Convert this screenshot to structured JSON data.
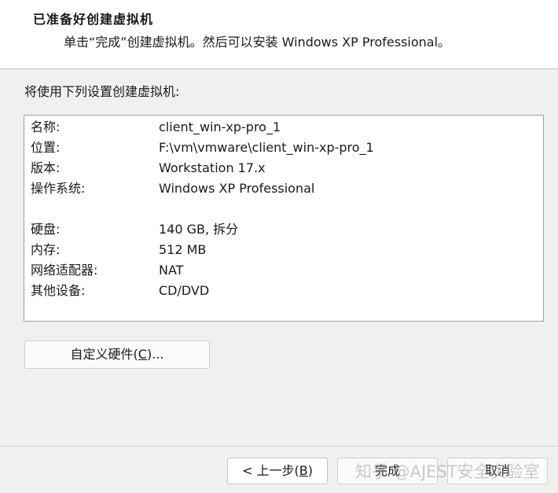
{
  "header": {
    "title": "已准备好创建虚拟机",
    "subtitle": "单击“完成”创建虚拟机。然后可以安装 Windows XP Professional。"
  },
  "intro": "将使用下列设置创建虚拟机:",
  "summary": [
    {
      "label": "名称:",
      "value": "client_win-xp-pro_1"
    },
    {
      "label": "位置:",
      "value": "F:\\vm\\vmware\\client_win-xp-pro_1"
    },
    {
      "label": "版本:",
      "value": "Workstation 17.x"
    },
    {
      "label": "操作系统:",
      "value": "Windows XP Professional"
    },
    {
      "label": "硬盘:",
      "value": "140 GB, 拆分"
    },
    {
      "label": "内存:",
      "value": "512 MB"
    },
    {
      "label": "网络适配器:",
      "value": "NAT"
    },
    {
      "label": "其他设备:",
      "value": "CD/DVD"
    }
  ],
  "buttons": {
    "customize_pre": "自定义硬件(",
    "customize_key": "C",
    "customize_post": ")...",
    "back_pre": "< 上一步(",
    "back_key": "B",
    "back_post": ")",
    "finish": "完成",
    "cancel": "取消"
  },
  "watermark": "知乎 @AJEST安全实验室"
}
